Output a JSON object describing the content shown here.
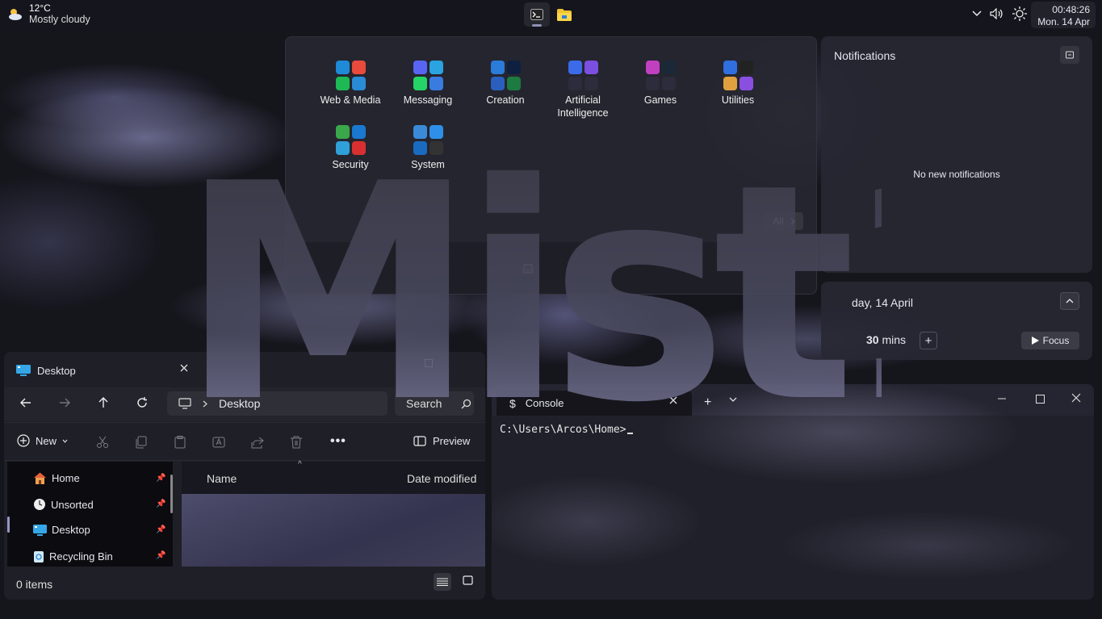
{
  "taskbar": {
    "weather_temp": "12°C",
    "weather_desc": "Mostly cloudy",
    "time": "00:48:26",
    "date": "Mon. 14 Apr"
  },
  "start_menu": {
    "folders": [
      {
        "label": "Web & Media",
        "colors": [
          "#1f8ad8",
          "#e84b3c",
          "#1db954",
          "#2a8bd6"
        ]
      },
      {
        "label": "Messaging",
        "colors": [
          "#5865f2",
          "#2aa3e0",
          "#25d366",
          "#3a7be0"
        ]
      },
      {
        "label": "Creation",
        "colors": [
          "#2b7cd8",
          "#0d2040",
          "#2b5fbd",
          "#1d7a40"
        ]
      },
      {
        "label": "Artificial Intelligence",
        "colors": [
          "#3b6be8",
          "#7b4fe0",
          "#2c2c3c",
          "#2c2c3c"
        ]
      },
      {
        "label": "Games",
        "colors": [
          "#c040c0",
          "#1b2838",
          "#2c2c3c",
          "#2c2c3c"
        ]
      },
      {
        "label": "Utilities",
        "colors": [
          "#2f6fe0",
          "#222",
          "#e0a040",
          "#8a4fe0"
        ]
      },
      {
        "label": "Security",
        "colors": [
          "#3aa84a",
          "#1a78d0",
          "#2fa0d8",
          "#d83030"
        ]
      },
      {
        "label": "System",
        "colors": [
          "#3a8ad8",
          "#2f8fe8",
          "#1a6ac0",
          "#333"
        ]
      }
    ],
    "all_label": "All"
  },
  "notifications": {
    "title": "Notifications",
    "empty": "No new notifications"
  },
  "calendar": {
    "date": "day, 14 April",
    "focus_minutes": "30",
    "focus_unit": "mins",
    "plus": "+",
    "focus_label": "Focus"
  },
  "explorer": {
    "tab_title": "Desktop",
    "address": "Desktop",
    "search_placeholder": "Search",
    "new_label": "New",
    "preview_label": "Preview",
    "sidebar": [
      {
        "label": "Home",
        "icon": "home-icon"
      },
      {
        "label": "Unsorted",
        "icon": "clock-icon"
      },
      {
        "label": "Desktop",
        "icon": "desktop-icon"
      },
      {
        "label": "Recycling Bin",
        "icon": "recycle-bin-icon"
      }
    ],
    "columns": [
      "Name",
      "Date modified"
    ],
    "status": "0 items"
  },
  "terminal": {
    "tab_title": "Console",
    "prompt": "C:\\Users\\Arcos\\Home>"
  },
  "wallpaper_text": "Mist11"
}
